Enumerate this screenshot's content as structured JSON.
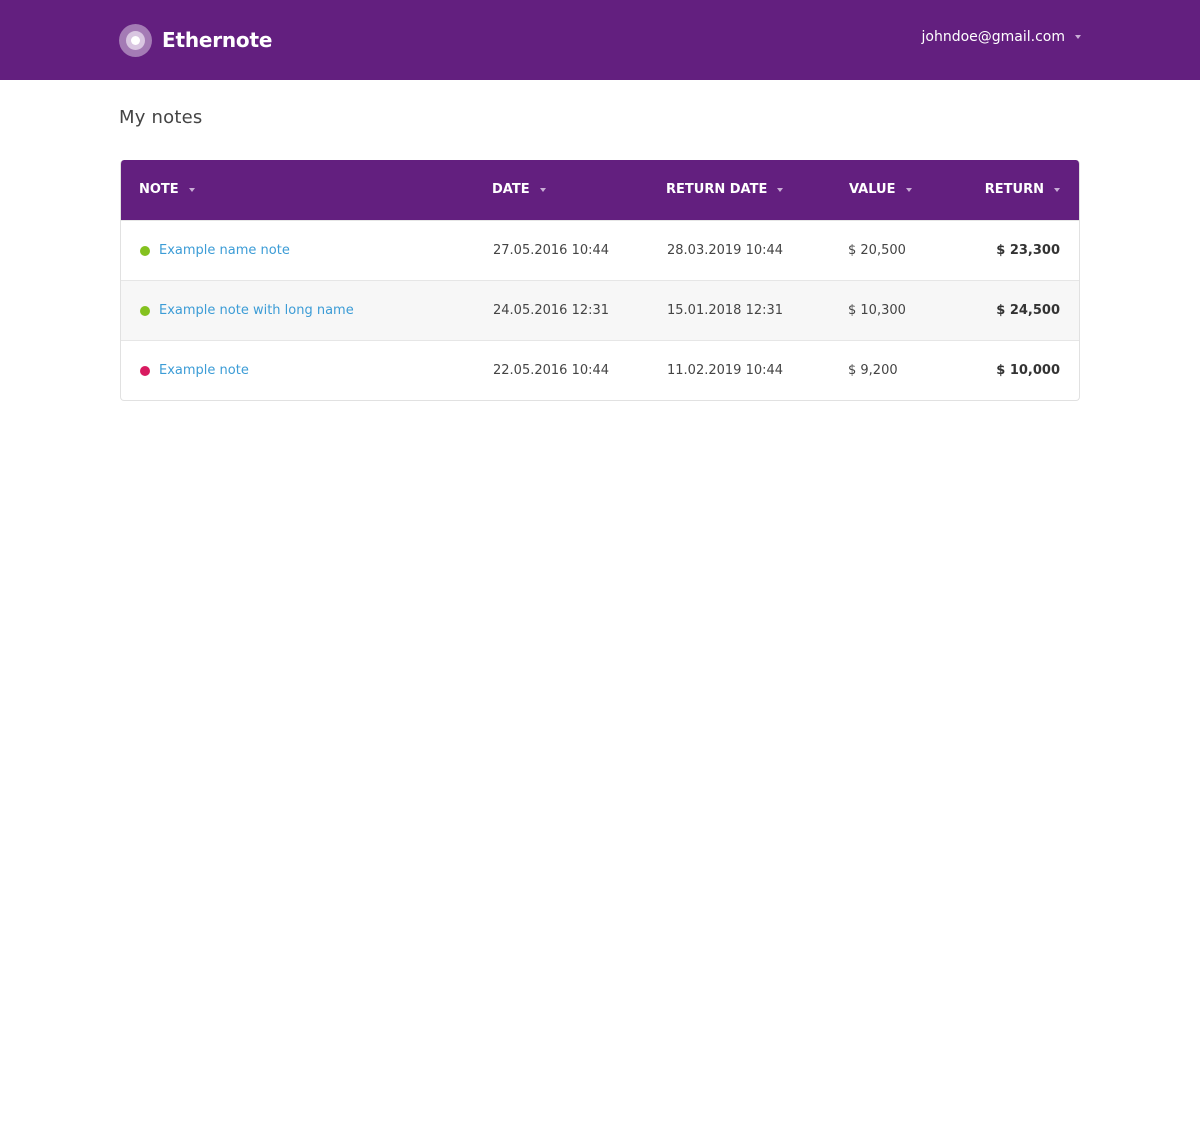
{
  "header": {
    "brand": "Ethernote",
    "user_email": "johndoe@gmail.com"
  },
  "page": {
    "title": "My notes"
  },
  "table": {
    "columns": [
      "NOTE",
      "DATE",
      "RETURN DATE",
      "VALUE",
      "RETURN"
    ],
    "rows": [
      {
        "status": "active",
        "status_color": "#84c11f",
        "name": "Example name note",
        "date": "27.05.2016 10:44",
        "return_date": "28.03.2019 10:44",
        "value": "$ 20,500",
        "return": "$ 23,300"
      },
      {
        "status": "active",
        "status_color": "#84c11f",
        "name": "Example note with long name",
        "date": "24.05.2016 12:31",
        "return_date": "15.01.2018 12:31",
        "value": "$ 10,300",
        "return": "$ 24,500"
      },
      {
        "status": "inactive",
        "status_color": "#d81b60",
        "name": "Example note",
        "date": "22.05.2016 10:44",
        "return_date": "11.02.2019 10:44",
        "value": "$ 9,200",
        "return": "$ 10,000"
      }
    ]
  },
  "colors": {
    "brand_purple": "#631f7f",
    "link_blue": "#3c9cd6",
    "status_green": "#84c11f",
    "status_red": "#d81b60"
  },
  "icons": {
    "logo": "ethernote-logo-icon",
    "user_menu": "caret-down-icon",
    "sort": "sort-caret-icon"
  }
}
